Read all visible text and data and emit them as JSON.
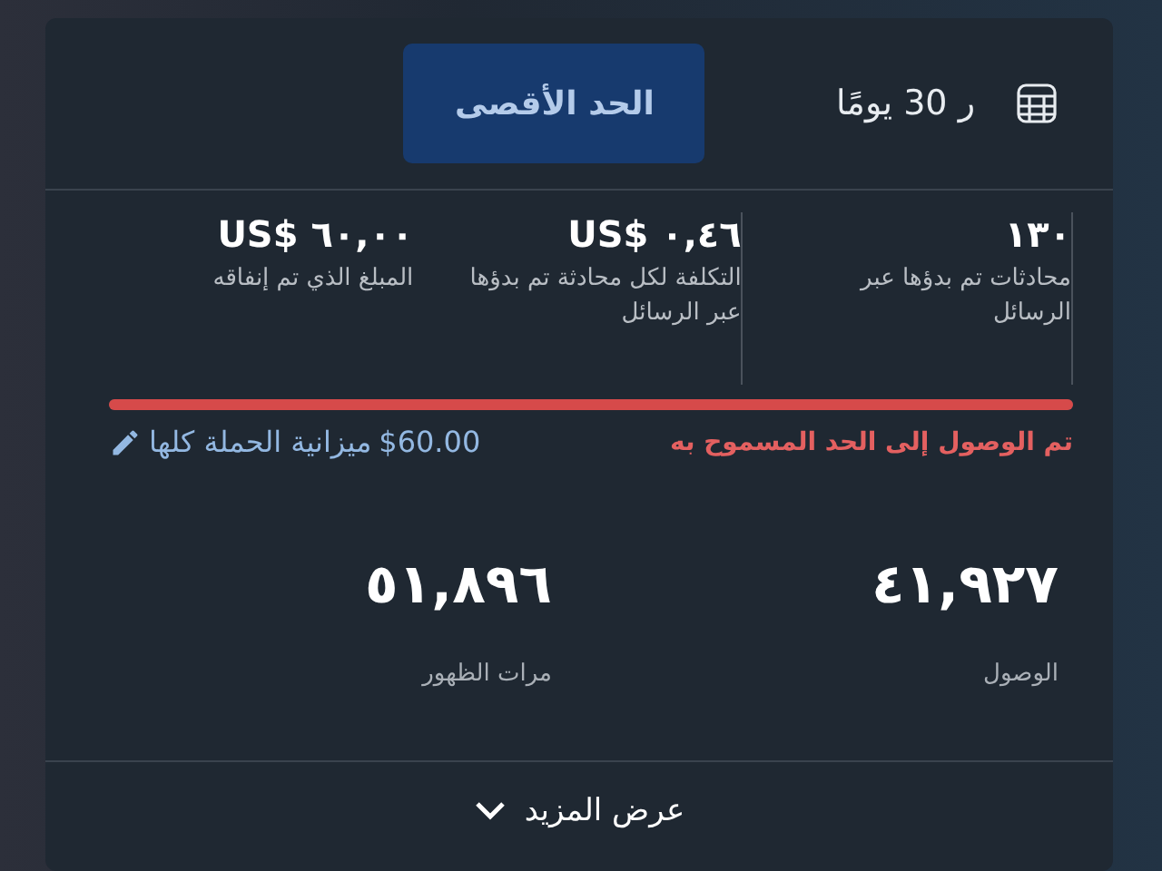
{
  "header": {
    "period": "ر 30 يومًا",
    "button": "الحد الأقصى"
  },
  "stats": [
    {
      "value": "١٣٠",
      "label": "محادثات تم بدؤها عبر الرسائل"
    },
    {
      "value": "US$ ٠,٤٦",
      "label": "التكلفة لكل محادثة تم بدؤها عبر الرسائل"
    },
    {
      "value": "US$ ٦٠,٠٠",
      "label": "المبلغ الذي تم إنفاقه"
    }
  ],
  "budget": {
    "level": 1,
    "status": "تم الوصول إلى الحد المسموح به",
    "amount": "$60.00",
    "amount_label": "ميزانية الحملة كلها"
  },
  "metrics": [
    {
      "value": "٤١,٩٢٧",
      "label": "الوصول"
    },
    {
      "value": "٥١,٨٩٦",
      "label": "مرات الظهور"
    }
  ],
  "show_more": "عرض المزيد"
}
